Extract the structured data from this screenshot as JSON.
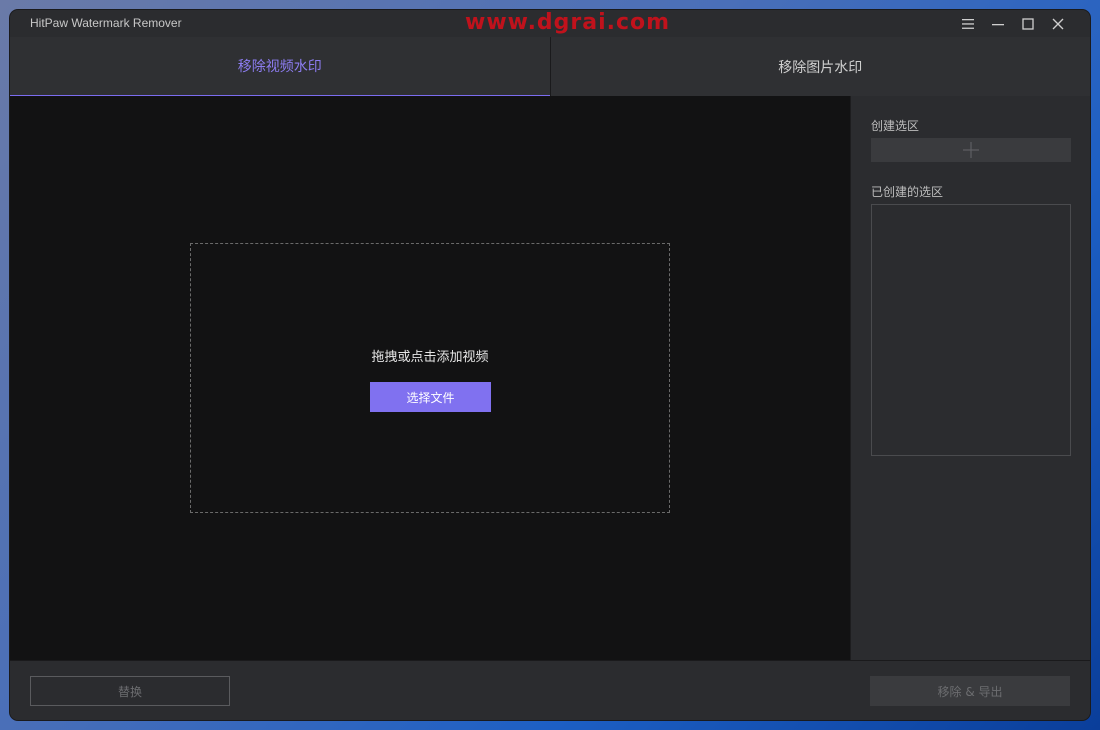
{
  "window": {
    "title": "HitPaw Watermark Remover",
    "overlay_watermark": "www.dgrai.com"
  },
  "controls": {
    "menu_icon": "hamburger-menu-icon",
    "minimize_icon": "minimize-icon",
    "maximize_icon": "maximize-icon",
    "close_icon": "close-icon"
  },
  "tabs": [
    {
      "label": "移除视频水印",
      "active": true
    },
    {
      "label": "移除图片水印",
      "active": false
    }
  ],
  "dropzone": {
    "hint": "拖拽或点击添加视频",
    "button_label": "选择文件"
  },
  "sidepanel": {
    "create_region_label": "创建选区",
    "add_icon": "plus-icon",
    "created_regions_label": "已创建的选区"
  },
  "bottom": {
    "replace_label": "替换",
    "export_label": "移除 & 导出"
  },
  "colors": {
    "accent": "#8071f0",
    "background": "#2b2c2f",
    "canvas": "#121213",
    "watermark_red": "#c0121c"
  }
}
